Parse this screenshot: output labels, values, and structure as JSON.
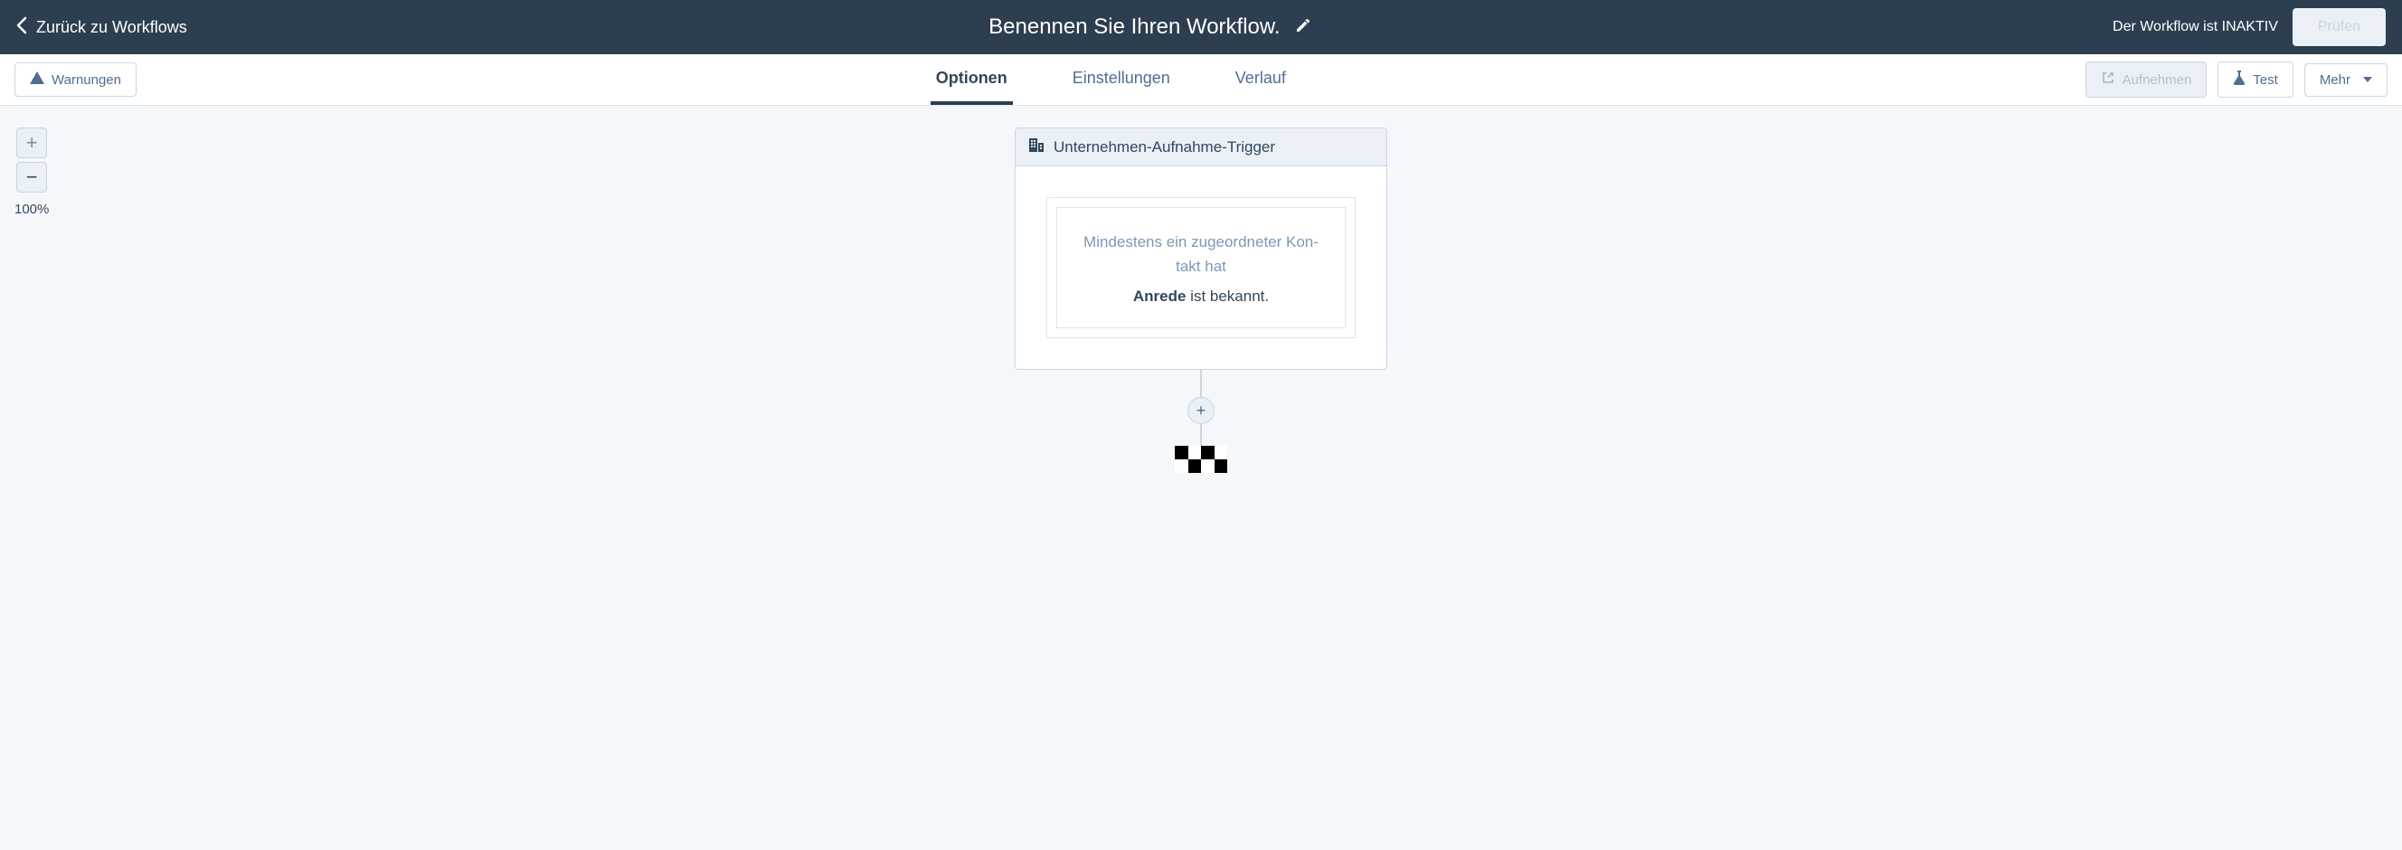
{
  "header": {
    "back_label": "Zurück zu Workflows",
    "title": "Benennen Sie Ihren Workflow.",
    "status": "Der Workflow ist INAKTIV",
    "review_button": "Prüfen"
  },
  "toolbar": {
    "warnings_label": "Warnungen",
    "tabs": [
      {
        "label": "Optionen",
        "active": true
      },
      {
        "label": "Einstellungen",
        "active": false
      },
      {
        "label": "Verlauf",
        "active": false
      }
    ],
    "enroll_label": "Aufnehmen",
    "test_label": "Test",
    "more_label": "Mehr"
  },
  "zoom": {
    "level": "100%"
  },
  "trigger": {
    "title": "Unternehmen-Aufnahme-Trigger",
    "filter_pretext": "Mindestens ein zugeordneter Kon­takt hat",
    "condition_property": "Anrede",
    "condition_rest": " ist bekannt."
  }
}
